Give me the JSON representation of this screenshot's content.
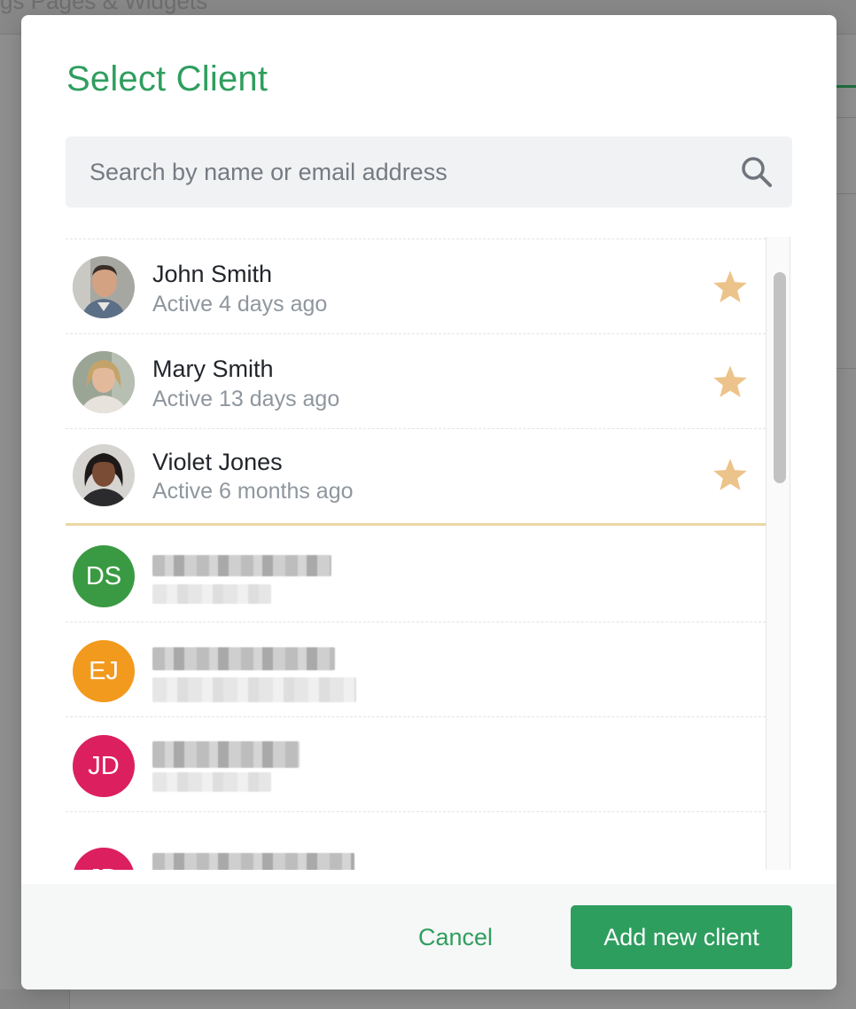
{
  "background": {
    "title": "gs Pages & Widgets"
  },
  "modal": {
    "title": "Select Client",
    "search": {
      "placeholder": "Search by name or email address",
      "value": ""
    },
    "favorites": [
      {
        "name": "John Smith",
        "activity": "Active 4 days ago",
        "avatar": "photo",
        "favorite": true
      },
      {
        "name": "Mary Smith",
        "activity": "Active 13 days ago",
        "avatar": "photo",
        "favorite": true
      },
      {
        "name": "Violet Jones",
        "activity": "Active 6 months ago",
        "avatar": "photo",
        "favorite": true
      }
    ],
    "clients": [
      {
        "initials": "DS",
        "color": "#3a9a43",
        "name_redacted": true
      },
      {
        "initials": "EJ",
        "color": "#f29a1e",
        "name_redacted": true
      },
      {
        "initials": "JD",
        "color": "#dc1f5f",
        "name_redacted": true
      },
      {
        "initials": "JD",
        "color": "#dc1f5f",
        "name_redacted": true
      }
    ],
    "footer": {
      "cancel_label": "Cancel",
      "add_label": "Add new client"
    }
  },
  "colors": {
    "accent": "#2f9e5e",
    "star": "#ecc38a",
    "favorites_divider": "#ecd6a6",
    "scrim": "#8f8f8f"
  },
  "icons": {
    "search": "search-icon",
    "favorite": "star-icon"
  }
}
